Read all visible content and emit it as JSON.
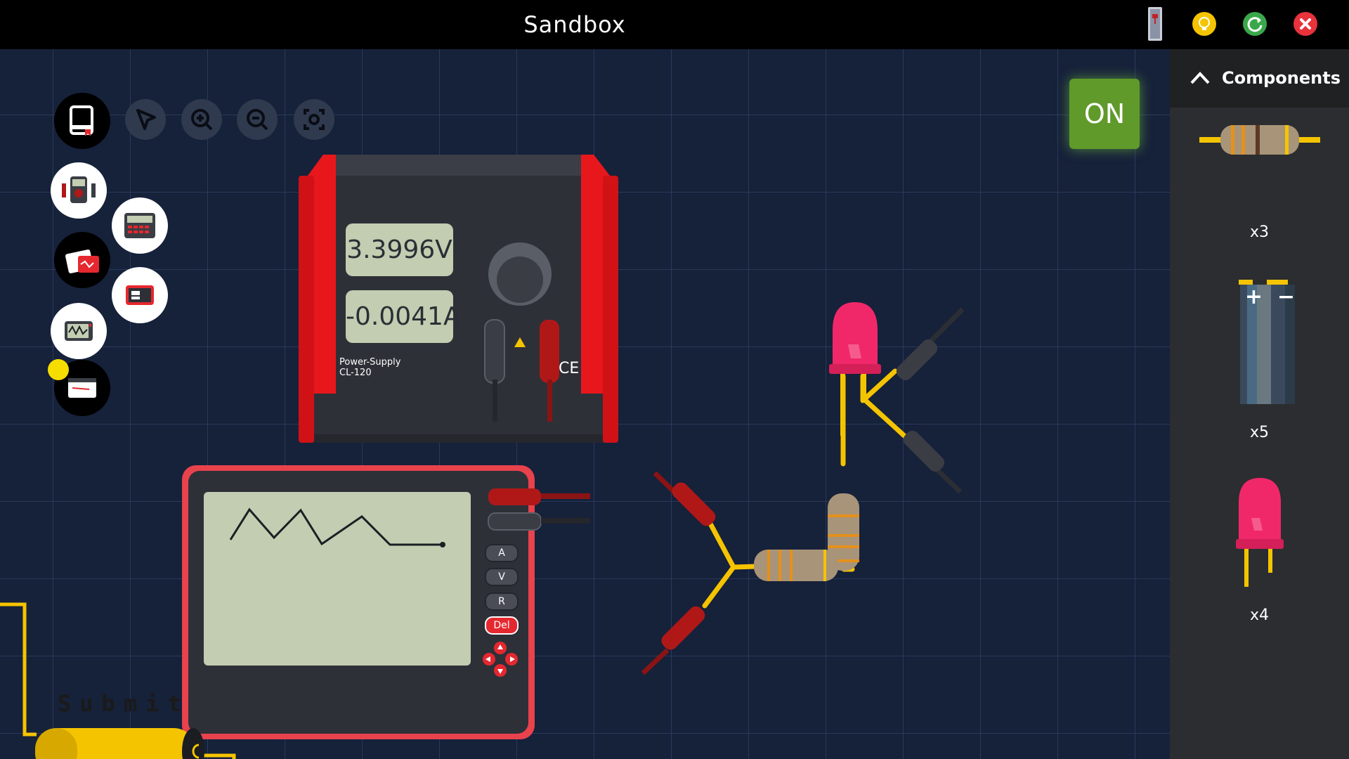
{
  "window": {
    "title": "Sandbox",
    "top_buttons": [
      {
        "name": "instrument-thumbnail-button",
        "icon": "device-thumbnail-icon"
      },
      {
        "name": "hint-button",
        "icon": "lightbulb-icon",
        "color": "#f5c400"
      },
      {
        "name": "reset-button",
        "icon": "refresh-icon",
        "color": "#3aa84a"
      },
      {
        "name": "close-button",
        "icon": "close-icon",
        "color": "#e8323c"
      }
    ]
  },
  "toolbar": {
    "tools": [
      "book-icon",
      "pointer-icon",
      "zoom-in-icon",
      "zoom-out-icon",
      "fit-view-icon"
    ],
    "instruments": [
      "multimeter-icon",
      "calculator-icon",
      "power-supply-icon",
      "battery-pack-icon",
      "oscilloscope-icon",
      "monitor-icon"
    ]
  },
  "power_supply": {
    "voltage": "3.3996V",
    "current": "-0.0041A",
    "model_line1": "Power-Supply",
    "model_line2": "CL-120",
    "ce_mark": "CE",
    "accent_color": "#e8171c"
  },
  "oscilloscope": {
    "buttons": [
      "A",
      "V",
      "R",
      "Del"
    ],
    "nav_icon": "dpad-icon"
  },
  "power_toggle": {
    "label": "ON",
    "color": "#5f9a2a"
  },
  "submit": {
    "label": "Submit"
  },
  "components_panel": {
    "title": "Components",
    "items": [
      {
        "name": "resistor",
        "icon": "resistor-icon",
        "count": "x3"
      },
      {
        "name": "battery",
        "icon": "battery-icon",
        "count": "x5",
        "plus": "+",
        "minus": "−"
      },
      {
        "name": "led",
        "icon": "led-icon",
        "count": "x4"
      }
    ]
  },
  "colors": {
    "wire": "#f5c400",
    "led": "#f0286a",
    "probe_red": "#b01818",
    "probe_black": "#3a3d44",
    "grid": "#2a3a5c",
    "background": "#16213a"
  }
}
